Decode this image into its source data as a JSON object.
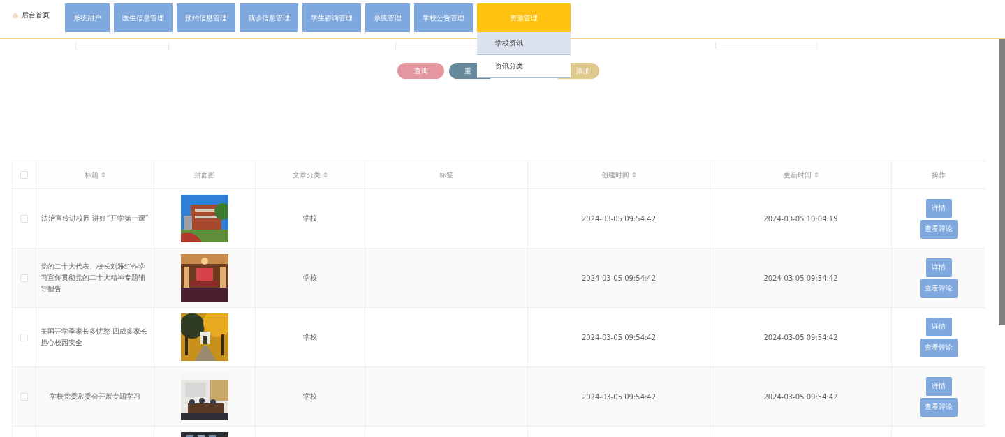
{
  "nav": {
    "home": {
      "label": "后台首页",
      "selected": false
    },
    "items": [
      {
        "label": "系统用户",
        "selected": false
      },
      {
        "label": "医生信息管理",
        "selected": false
      },
      {
        "label": "预约信息管理",
        "selected": false
      },
      {
        "label": "就诊信息管理",
        "selected": false
      },
      {
        "label": "学生咨询管理",
        "selected": false
      },
      {
        "label": "系统管理",
        "selected": false
      },
      {
        "label": "学校公告管理",
        "selected": false
      },
      {
        "label": "资源管理",
        "selected": true,
        "expanded": true,
        "menu": [
          {
            "label": "学校资讯",
            "selected": true
          },
          {
            "label": "资讯分类",
            "selected": false
          }
        ]
      }
    ]
  },
  "search": {
    "fields": [
      {
        "kind": "text"
      },
      {
        "kind": "text"
      },
      {
        "kind": "select"
      }
    ],
    "buttons": [
      {
        "label": "查询",
        "color": "#e4979e"
      },
      {
        "label": "重",
        "color": "#668a9c"
      },
      {
        "label": "添加",
        "color": "#e0c98d"
      }
    ]
  },
  "table": {
    "select_all_checked": false,
    "columns": [
      {
        "label": "标题",
        "sortable": true
      },
      {
        "label": "封面图",
        "sortable": false
      },
      {
        "label": "文章分类",
        "sortable": true
      },
      {
        "label": "标签",
        "sortable": false
      },
      {
        "label": "创建时间",
        "sortable": true
      },
      {
        "label": "更新时间",
        "sortable": true
      },
      {
        "label": "操作",
        "sortable": false
      }
    ],
    "rows": [
      {
        "checked": false,
        "title": "法治宣传进校园 讲好“开学第一课”",
        "cover": {
          "kind": "picture"
        },
        "category": "学校",
        "created": "2024-03-05 09:54:42",
        "updated": "2024-03-05 10:04:19",
        "actions": [
          "详情",
          "查看评论"
        ]
      },
      {
        "checked": false,
        "title": "党的二十大代表、校长刘雅红作学习宣传贯彻党的二十大精神专题辅导报告",
        "cover": {
          "kind": "picture"
        },
        "category": "学校",
        "created": "2024-03-05 09:54:42",
        "updated": "2024-03-05 09:54:42",
        "actions": [
          "详情",
          "查看评论"
        ]
      },
      {
        "checked": false,
        "title": "美国开学季家长多忧愁 四成多家长担心校园安全",
        "cover": {
          "kind": "picture"
        },
        "category": "学校",
        "created": "2024-03-05 09:54:42",
        "updated": "2024-03-05 09:54:42",
        "actions": [
          "详情",
          "查看评论"
        ]
      },
      {
        "checked": false,
        "title": "学校党委常委会开展专题学习",
        "cover": {
          "kind": "picture"
        },
        "category": "学校",
        "created": "2024-03-05 09:54:42",
        "updated": "2024-03-05 09:54:42",
        "actions": [
          "详情",
          "查看评论"
        ]
      },
      {
        "cover": {
          "kind": "picture"
        }
      }
    ]
  }
}
